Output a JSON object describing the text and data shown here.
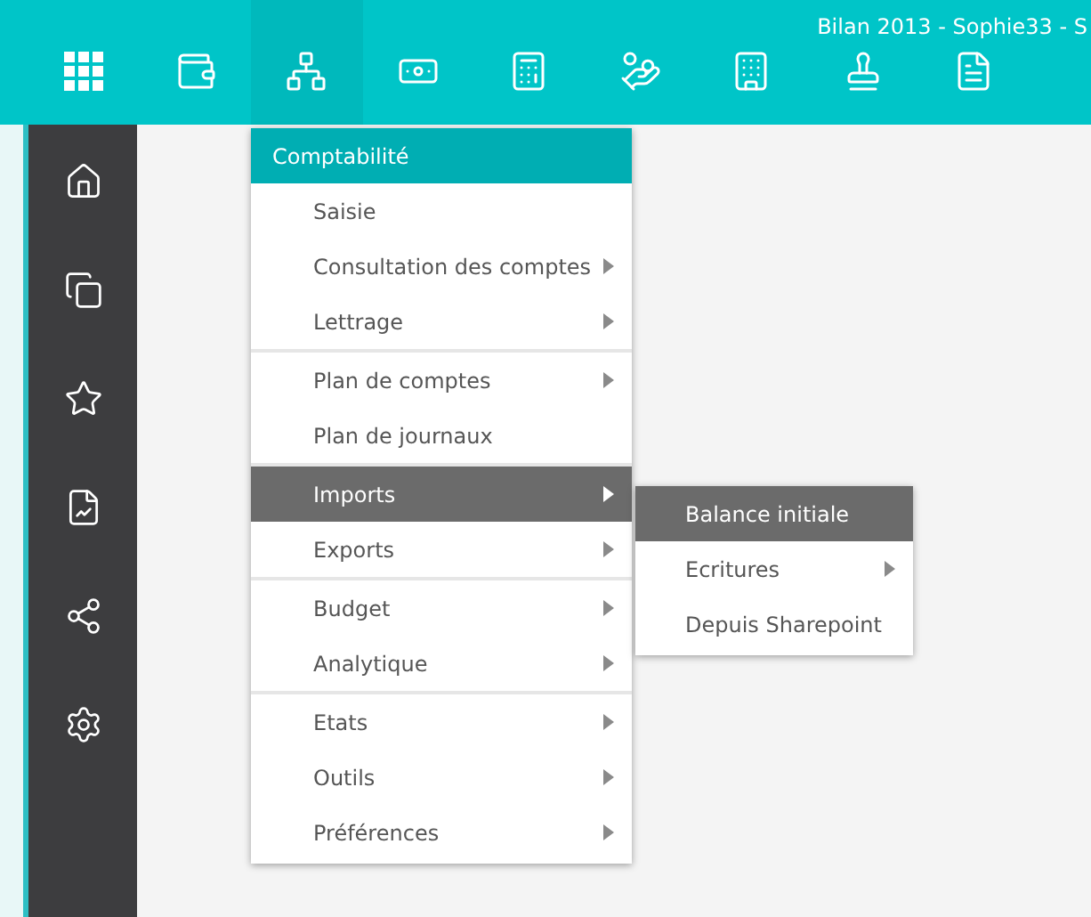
{
  "window": {
    "title": "Bilan 2013 - Sophie33 - S"
  },
  "toolbar": {
    "items": [
      {
        "selected": false
      },
      {
        "selected": false
      },
      {
        "selected": true
      },
      {
        "selected": false
      },
      {
        "selected": false
      },
      {
        "selected": false
      },
      {
        "selected": false
      },
      {
        "selected": false
      },
      {
        "selected": false
      }
    ]
  },
  "menu": {
    "title": "Comptabilité",
    "groups": [
      {
        "items": [
          {
            "label": "Saisie",
            "has_submenu": false,
            "selected": false
          },
          {
            "label": "Consultation des comptes",
            "has_submenu": true,
            "selected": false
          },
          {
            "label": "Lettrage",
            "has_submenu": true,
            "selected": false
          }
        ]
      },
      {
        "items": [
          {
            "label": "Plan de comptes",
            "has_submenu": true,
            "selected": false
          },
          {
            "label": "Plan de journaux",
            "has_submenu": false,
            "selected": false
          }
        ]
      },
      {
        "items": [
          {
            "label": "Imports",
            "has_submenu": true,
            "selected": true
          },
          {
            "label": "Exports",
            "has_submenu": true,
            "selected": false
          }
        ]
      },
      {
        "items": [
          {
            "label": "Budget",
            "has_submenu": true,
            "selected": false
          },
          {
            "label": "Analytique",
            "has_submenu": true,
            "selected": false
          }
        ]
      },
      {
        "items": [
          {
            "label": "Etats",
            "has_submenu": true,
            "selected": false
          },
          {
            "label": "Outils",
            "has_submenu": true,
            "selected": false
          },
          {
            "label": "Préférences",
            "has_submenu": true,
            "selected": false
          }
        ]
      }
    ]
  },
  "submenu": {
    "items": [
      {
        "label": "Balance initiale",
        "has_submenu": false,
        "selected": true
      },
      {
        "label": "Ecritures",
        "has_submenu": true,
        "selected": false
      },
      {
        "label": "Depuis Sharepoint",
        "has_submenu": false,
        "selected": false
      }
    ]
  }
}
